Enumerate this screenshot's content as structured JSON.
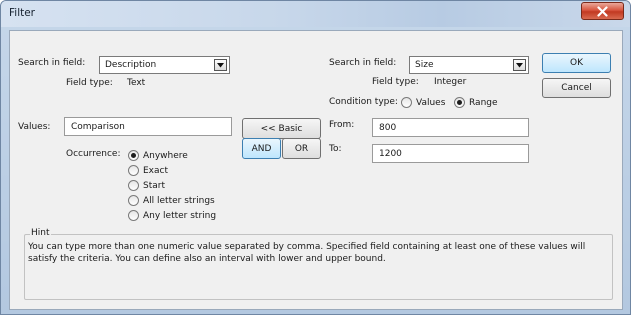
{
  "window": {
    "title": "Filter"
  },
  "left": {
    "search_label": "Search in field:",
    "search_value": "Description",
    "field_type_label": "Field type:",
    "field_type_value": "Text",
    "values_label": "Values:",
    "values_value": "Comparison",
    "occurrence_label": "Occurrence:",
    "occurrence_options": [
      {
        "label": "Anywhere",
        "checked": true
      },
      {
        "label": "Exact",
        "checked": false
      },
      {
        "label": "Start",
        "checked": false
      },
      {
        "label": "All letter strings",
        "checked": false
      },
      {
        "label": "Any letter string",
        "checked": false
      }
    ]
  },
  "middle": {
    "basic_label": "<< Basic",
    "and_label": "AND",
    "or_label": "OR"
  },
  "right": {
    "search_label": "Search in field:",
    "search_value": "Size",
    "field_type_label": "Field type:",
    "field_type_value": "Integer",
    "condition_label": "Condition type:",
    "condition_values_label": "Values",
    "condition_range_label": "Range",
    "condition_selected": "Range",
    "from_label": "From:",
    "from_value": "800",
    "to_label": "To:",
    "to_value": "1200"
  },
  "buttons": {
    "ok_label": "OK",
    "cancel_label": "Cancel"
  },
  "hint": {
    "title": "Hint",
    "text": "You can type more than one numeric value separated by comma. Specified field containing at least one of these values will satisfy the criteria. You can define also an interval with lower and upper bound."
  },
  "icons": {
    "close": "close-icon",
    "dropdown": "chevron-down-icon"
  },
  "colors": {
    "close_button": "#c8462c",
    "active_button": "#bee6fd"
  }
}
